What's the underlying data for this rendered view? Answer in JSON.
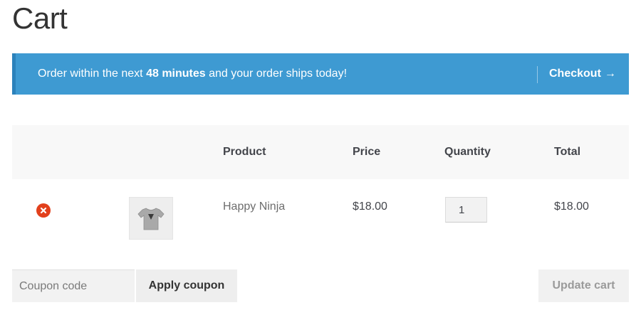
{
  "page": {
    "title": "Cart"
  },
  "notice": {
    "text_before": "Order within the next ",
    "text_bold": "48 minutes",
    "text_after": " and your order ships today!",
    "checkout_label": "Checkout",
    "arrow_glyph": "→"
  },
  "table": {
    "headers": {
      "product": "Product",
      "price": "Price",
      "quantity": "Quantity",
      "total": "Total"
    },
    "rows": [
      {
        "name": "Happy Ninja",
        "price": "$18.00",
        "quantity": "1",
        "total": "$18.00"
      }
    ]
  },
  "actions": {
    "coupon_placeholder": "Coupon code",
    "apply_coupon_label": "Apply coupon",
    "update_cart_label": "Update cart"
  },
  "colors": {
    "notice_bg": "#3e9ad2",
    "remove_icon": "#e2401c"
  },
  "icons": {
    "remove": "remove-circle-x-icon",
    "thumbnail": "tshirt-thumbnail",
    "arrow": "right-arrow-icon"
  }
}
